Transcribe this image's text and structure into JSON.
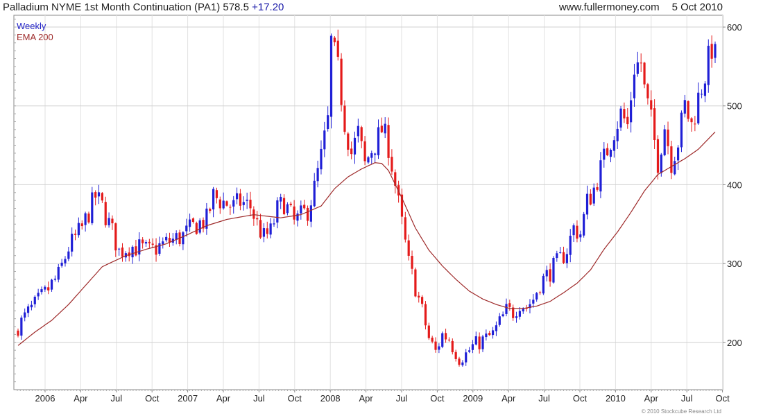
{
  "header": {
    "title": "Palladium NYME 1st Month Continuation (PA1)",
    "last": "578.5",
    "change": "+17.20",
    "source": "www.fullermoney.com",
    "date": "5 Oct 2010"
  },
  "legend": {
    "series1": "Weekly",
    "series2": "EMA 200"
  },
  "credit": "© 2010 Stockcube Research Ltd",
  "chart_data": {
    "type": "candlestick",
    "grid": true,
    "yaxis_side": "right",
    "ylim": [
      140,
      615
    ],
    "yticks": [
      200,
      300,
      400,
      500,
      600
    ],
    "xlabels": [
      "2006",
      "Apr",
      "Jul",
      "Oct",
      "2007",
      "Apr",
      "Jul",
      "Oct",
      "2008",
      "Apr",
      "Jul",
      "Oct",
      "2009",
      "Apr",
      "Jul",
      "Oct",
      "2010",
      "Apr",
      "Jul",
      "Oct"
    ],
    "colors": {
      "up": "#1f1fd6",
      "down": "#e41a1a",
      "ema": "#9e2a2a",
      "grid": "#d0d0d0"
    },
    "weekly_close_keypoints": [
      [
        0,
        220
      ],
      [
        3,
        238
      ],
      [
        8,
        262
      ],
      [
        12,
        285
      ],
      [
        15,
        320
      ],
      [
        19,
        345
      ],
      [
        23,
        385
      ],
      [
        25,
        372
      ],
      [
        28,
        340
      ],
      [
        30,
        315
      ],
      [
        33,
        322
      ],
      [
        36,
        320
      ],
      [
        39,
        315
      ],
      [
        42,
        322
      ],
      [
        45,
        328
      ],
      [
        49,
        335
      ],
      [
        53,
        350
      ],
      [
        56,
        355
      ],
      [
        58,
        385
      ],
      [
        61,
        378
      ],
      [
        64,
        372
      ],
      [
        66,
        378
      ],
      [
        69,
        372
      ],
      [
        71,
        350
      ],
      [
        73,
        333
      ],
      [
        75,
        340
      ],
      [
        77,
        368
      ],
      [
        79,
        378
      ],
      [
        82,
        352
      ],
      [
        84,
        360
      ],
      [
        86,
        368
      ],
      [
        88,
        395
      ],
      [
        90,
        435
      ],
      [
        92,
        480
      ],
      [
        93,
        580
      ],
      [
        95,
        545
      ],
      [
        97,
        480
      ],
      [
        99,
        440
      ],
      [
        101,
        465
      ],
      [
        103,
        425
      ],
      [
        105,
        445
      ],
      [
        107,
        460
      ],
      [
        108,
        470
      ],
      [
        110,
        450
      ],
      [
        112,
        400
      ],
      [
        114,
        350
      ],
      [
        116,
        300
      ],
      [
        118,
        270
      ],
      [
        120,
        240
      ],
      [
        122,
        205
      ],
      [
        124,
        188
      ],
      [
        126,
        210
      ],
      [
        128,
        205
      ],
      [
        129,
        195
      ],
      [
        131,
        180
      ],
      [
        133,
        185
      ],
      [
        135,
        195
      ],
      [
        137,
        200
      ],
      [
        139,
        205
      ],
      [
        141,
        210
      ],
      [
        143,
        225
      ],
      [
        145,
        240
      ],
      [
        147,
        238
      ],
      [
        149,
        250
      ],
      [
        151,
        245
      ],
      [
        153,
        255
      ],
      [
        155,
        275
      ],
      [
        157,
        285
      ],
      [
        159,
        295
      ],
      [
        161,
        305
      ],
      [
        163,
        318
      ],
      [
        165,
        345
      ],
      [
        167,
        338
      ],
      [
        169,
        378
      ],
      [
        171,
        395
      ],
      [
        173,
        420
      ],
      [
        175,
        445
      ],
      [
        177,
        470
      ],
      [
        179,
        490
      ],
      [
        181,
        475
      ],
      [
        183,
        550
      ],
      [
        185,
        555
      ],
      [
        186,
        520
      ],
      [
        188,
        480
      ],
      [
        190,
        430
      ],
      [
        192,
        475
      ],
      [
        194,
        430
      ],
      [
        196,
        455
      ],
      [
        198,
        500
      ],
      [
        200,
        475
      ],
      [
        202,
        510
      ],
      [
        204,
        540
      ],
      [
        206,
        575
      ],
      [
        207,
        578.5
      ]
    ],
    "ema200_keypoints": [
      [
        0,
        196
      ],
      [
        5,
        213
      ],
      [
        10,
        228
      ],
      [
        15,
        248
      ],
      [
        20,
        272
      ],
      [
        25,
        296
      ],
      [
        28,
        302
      ],
      [
        32,
        310
      ],
      [
        38,
        318
      ],
      [
        44,
        325
      ],
      [
        50,
        336
      ],
      [
        56,
        348
      ],
      [
        62,
        356
      ],
      [
        70,
        362
      ],
      [
        78,
        358
      ],
      [
        84,
        362
      ],
      [
        90,
        373
      ],
      [
        94,
        395
      ],
      [
        98,
        410
      ],
      [
        102,
        420
      ],
      [
        106,
        428
      ],
      [
        108,
        427
      ],
      [
        110,
        418
      ],
      [
        114,
        383
      ],
      [
        118,
        345
      ],
      [
        122,
        317
      ],
      [
        126,
        297
      ],
      [
        130,
        280
      ],
      [
        134,
        265
      ],
      [
        138,
        255
      ],
      [
        142,
        248
      ],
      [
        146,
        243
      ],
      [
        150,
        243
      ],
      [
        154,
        246
      ],
      [
        158,
        252
      ],
      [
        162,
        263
      ],
      [
        166,
        275
      ],
      [
        170,
        292
      ],
      [
        174,
        318
      ],
      [
        178,
        340
      ],
      [
        182,
        365
      ],
      [
        186,
        392
      ],
      [
        190,
        413
      ],
      [
        194,
        423
      ],
      [
        198,
        433
      ],
      [
        202,
        445
      ],
      [
        207,
        467
      ]
    ]
  }
}
